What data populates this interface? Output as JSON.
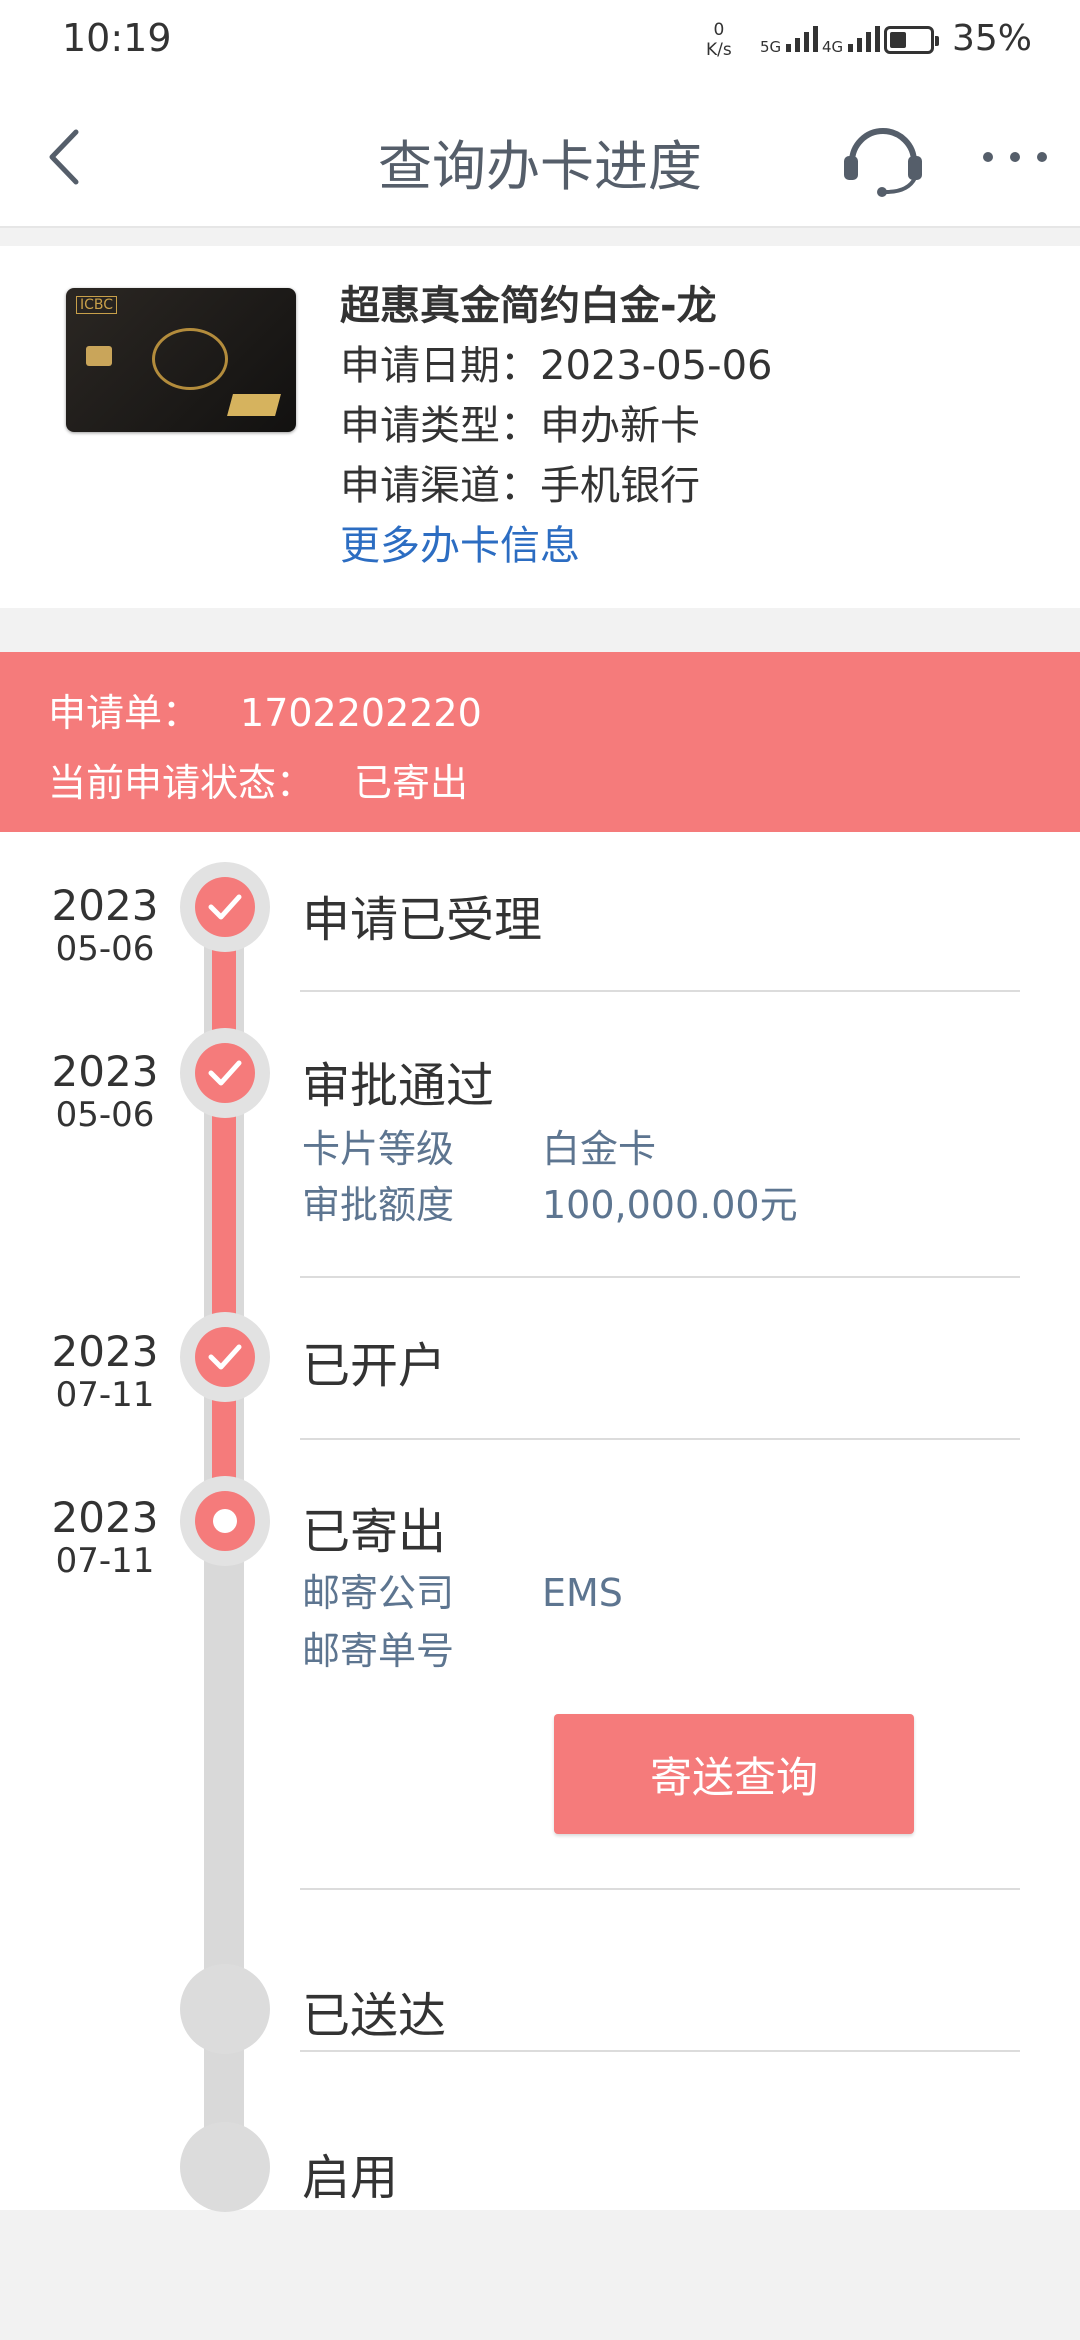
{
  "status_bar": {
    "time": "10:19",
    "net_speed_value": "0",
    "net_speed_unit": "K/s",
    "signal_1": "5G",
    "signal_2": "4G",
    "battery": "35%"
  },
  "nav": {
    "title": "查询办卡进度",
    "back_icon": "back-arrow-icon",
    "support_icon": "headset-icon",
    "more_icon": "more-dots-icon"
  },
  "card": {
    "name": "超惠真金简约白金-龙",
    "date_label": "申请日期：",
    "date_value": "2023-05-06",
    "type_label": "申请类型：",
    "type_value": "申办新卡",
    "channel_label": "申请渠道：",
    "channel_value": "手机银行",
    "more_link": "更多办卡信息",
    "card_brand_text": "ICBC"
  },
  "application": {
    "number_label": "申请单：",
    "number_value": "1702202220",
    "status_label": "当前申请状态：",
    "status_value": "已寄出"
  },
  "timeline": {
    "accent_color": "#f57b7b",
    "steps": [
      {
        "year": "2023",
        "md": "05-06",
        "title": "申请已受理",
        "state": "done"
      },
      {
        "year": "2023",
        "md": "05-06",
        "title": "审批通过",
        "state": "done",
        "details": [
          {
            "key": "卡片等级",
            "value": "白金卡"
          },
          {
            "key": "审批额度",
            "value": "100,000.00元"
          }
        ]
      },
      {
        "year": "2023",
        "md": "07-11",
        "title": "已开户",
        "state": "done"
      },
      {
        "year": "2023",
        "md": "07-11",
        "title": "已寄出",
        "state": "current",
        "details": [
          {
            "key": "邮寄公司",
            "value": "EMS"
          },
          {
            "key": "邮寄单号",
            "value": ""
          }
        ],
        "button": "寄送查询"
      },
      {
        "title": "已送达",
        "state": "pending"
      },
      {
        "title": "启用",
        "state": "pending"
      }
    ]
  }
}
